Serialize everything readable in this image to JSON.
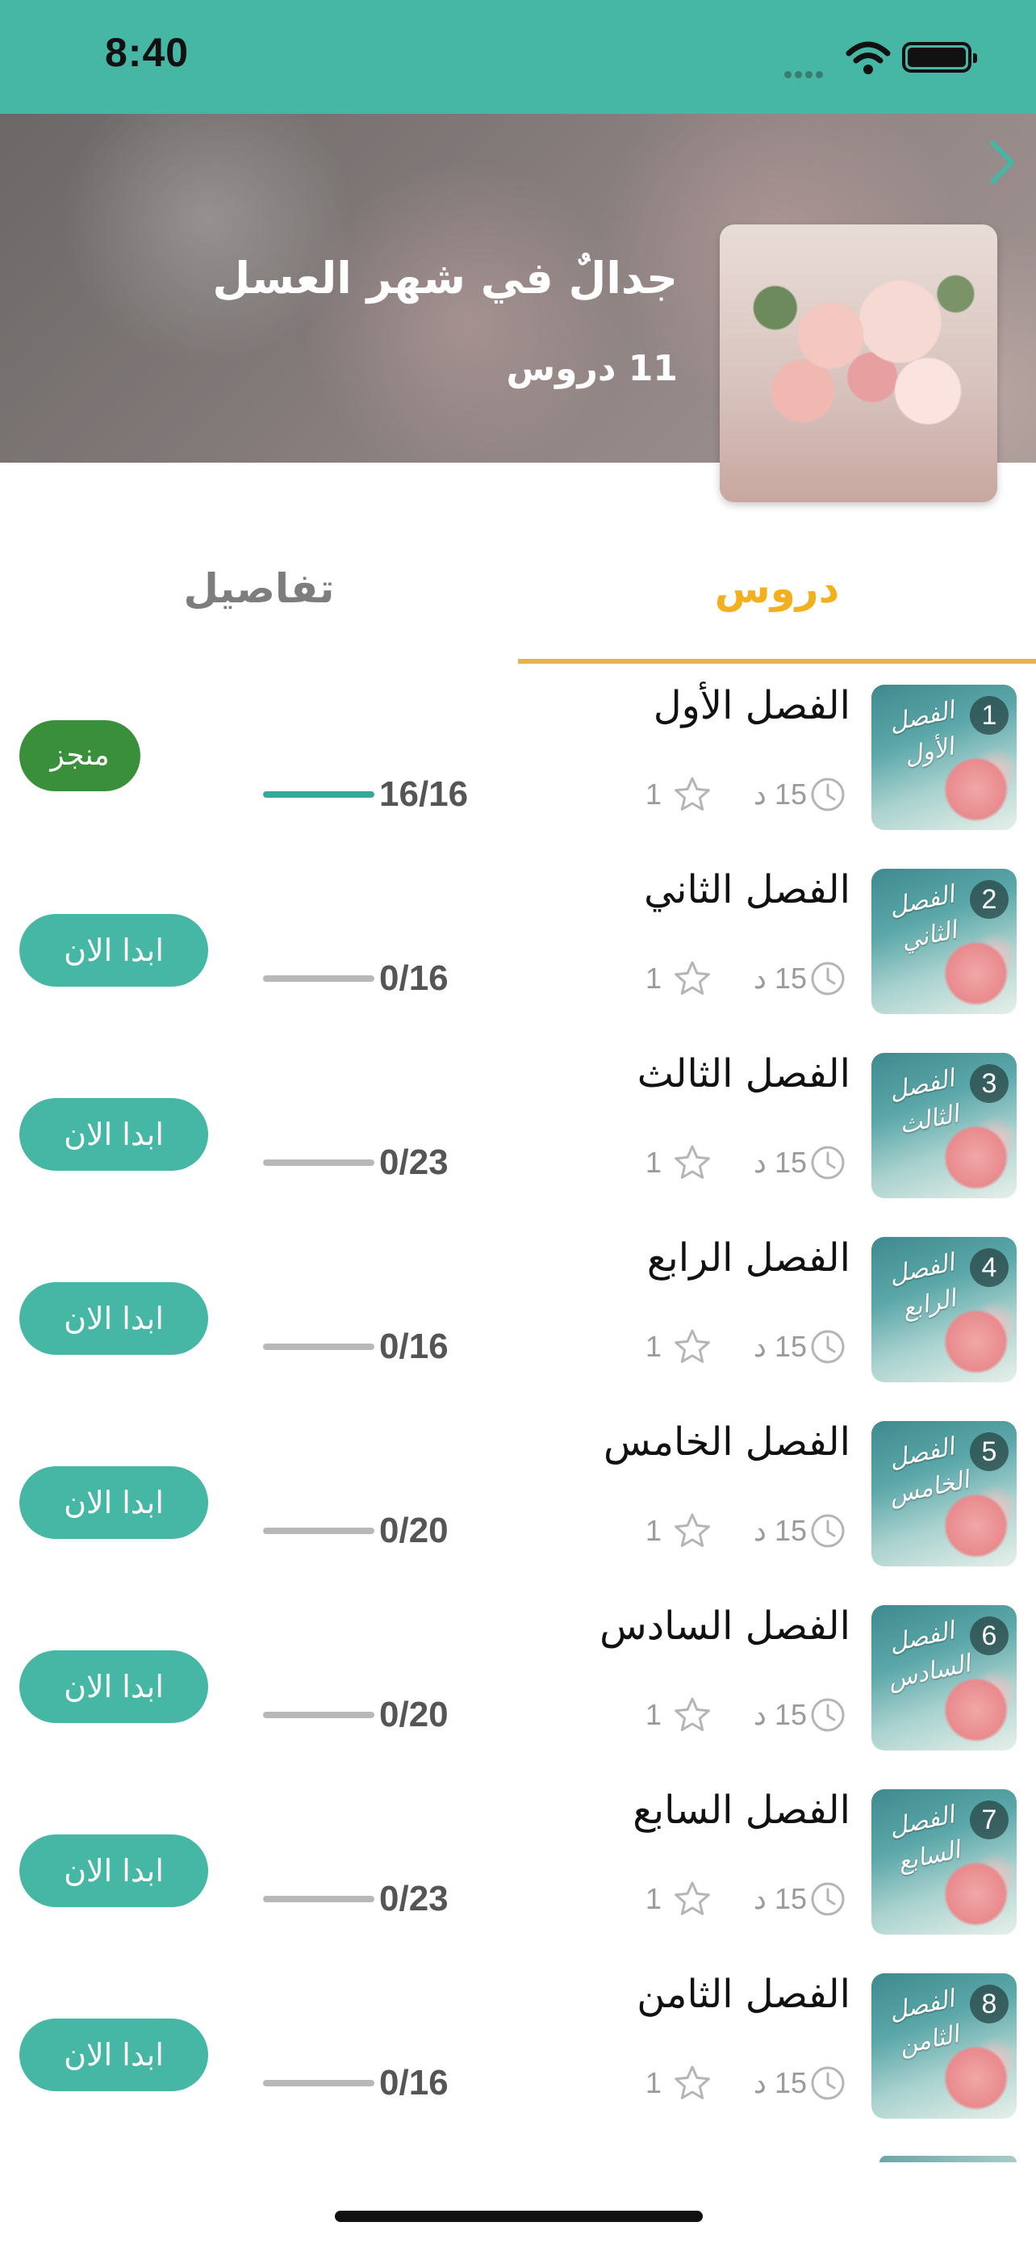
{
  "status_bar": {
    "time": "8:40"
  },
  "header": {
    "course_title": "جدالٌ في شهر العسل",
    "lessons_count": "11 دروس"
  },
  "tabs": {
    "lessons": "دروس",
    "details": "تفاصيل",
    "active": "lessons"
  },
  "colors": {
    "primary_teal": "#46b7a4",
    "tab_active": "#f2b01e",
    "done_green": "#3a8f3a",
    "progress_fill": "#36a99a"
  },
  "lessons": [
    {
      "number": "1",
      "title": "الفصل الأول",
      "thumb_text": "الفصل الأول",
      "duration": "15 د",
      "rating": "1",
      "progress_text": "16/16",
      "progress": 1.0,
      "button": "منجز",
      "done": true
    },
    {
      "number": "2",
      "title": "الفصل الثاني",
      "thumb_text": "الفصل الثاني",
      "duration": "15 د",
      "rating": "1",
      "progress_text": "0/16",
      "progress": 0.0,
      "button": "ابدا الان",
      "done": false
    },
    {
      "number": "3",
      "title": "الفصل الثالث",
      "thumb_text": "الفصل الثالث",
      "duration": "15 د",
      "rating": "1",
      "progress_text": "0/23",
      "progress": 0.0,
      "button": "ابدا الان",
      "done": false
    },
    {
      "number": "4",
      "title": "الفصل الرابع",
      "thumb_text": "الفصل الرابع",
      "duration": "15 د",
      "rating": "1",
      "progress_text": "0/16",
      "progress": 0.0,
      "button": "ابدا الان",
      "done": false
    },
    {
      "number": "5",
      "title": "الفصل الخامس",
      "thumb_text": "الفصل الخامس",
      "duration": "15 د",
      "rating": "1",
      "progress_text": "0/20",
      "progress": 0.0,
      "button": "ابدا الان",
      "done": false
    },
    {
      "number": "6",
      "title": "الفصل السادس",
      "thumb_text": "الفصل السادس",
      "duration": "15 د",
      "rating": "1",
      "progress_text": "0/20",
      "progress": 0.0,
      "button": "ابدا الان",
      "done": false
    },
    {
      "number": "7",
      "title": "الفصل السابع",
      "thumb_text": "الفصل السابع",
      "duration": "15 د",
      "rating": "1",
      "progress_text": "0/23",
      "progress": 0.0,
      "button": "ابدا الان",
      "done": false
    },
    {
      "number": "8",
      "title": "الفصل الثامن",
      "thumb_text": "الفصل الثامن",
      "duration": "15 د",
      "rating": "1",
      "progress_text": "0/16",
      "progress": 0.0,
      "button": "ابدا الان",
      "done": false
    }
  ]
}
